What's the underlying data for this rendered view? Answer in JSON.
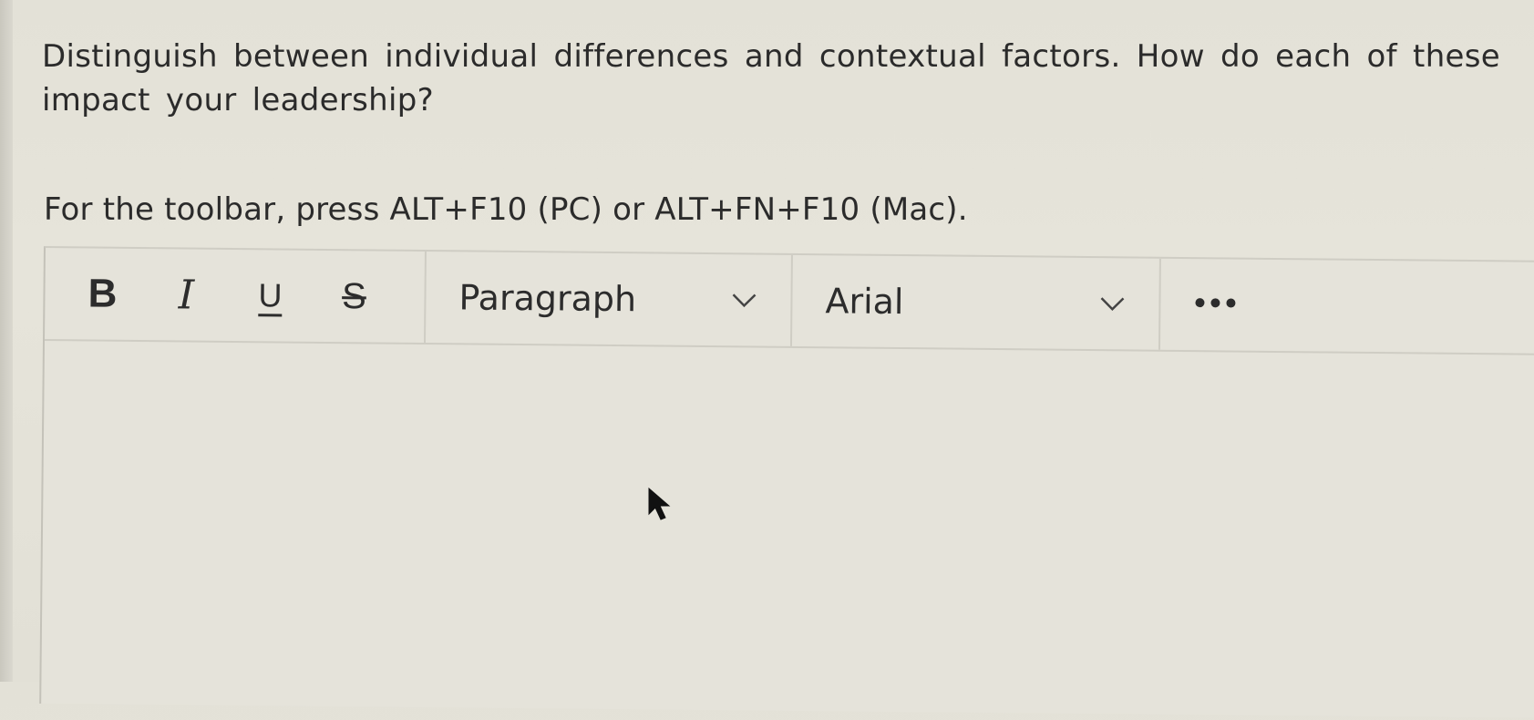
{
  "question": {
    "text": "Distinguish between individual differences and contextual factors. How do each of these impact your leadership?"
  },
  "toolbar_hint": "For the toolbar, press ALT+F10 (PC) or ALT+FN+F10 (Mac).",
  "toolbar": {
    "bold_label": "B",
    "italic_label": "I",
    "underline_label": "U",
    "strikethrough_label": "S",
    "paragraph_select": {
      "value": "Paragraph",
      "icon": "chevron-down-icon"
    },
    "font_select": {
      "value": "Arial",
      "icon": "chevron-down-icon"
    },
    "more_icon": "ellipsis-icon"
  },
  "editor": {
    "content": ""
  },
  "colors": {
    "background": "#e4e2d8",
    "text": "#2b2b2b",
    "border": "#cfcdc4"
  }
}
